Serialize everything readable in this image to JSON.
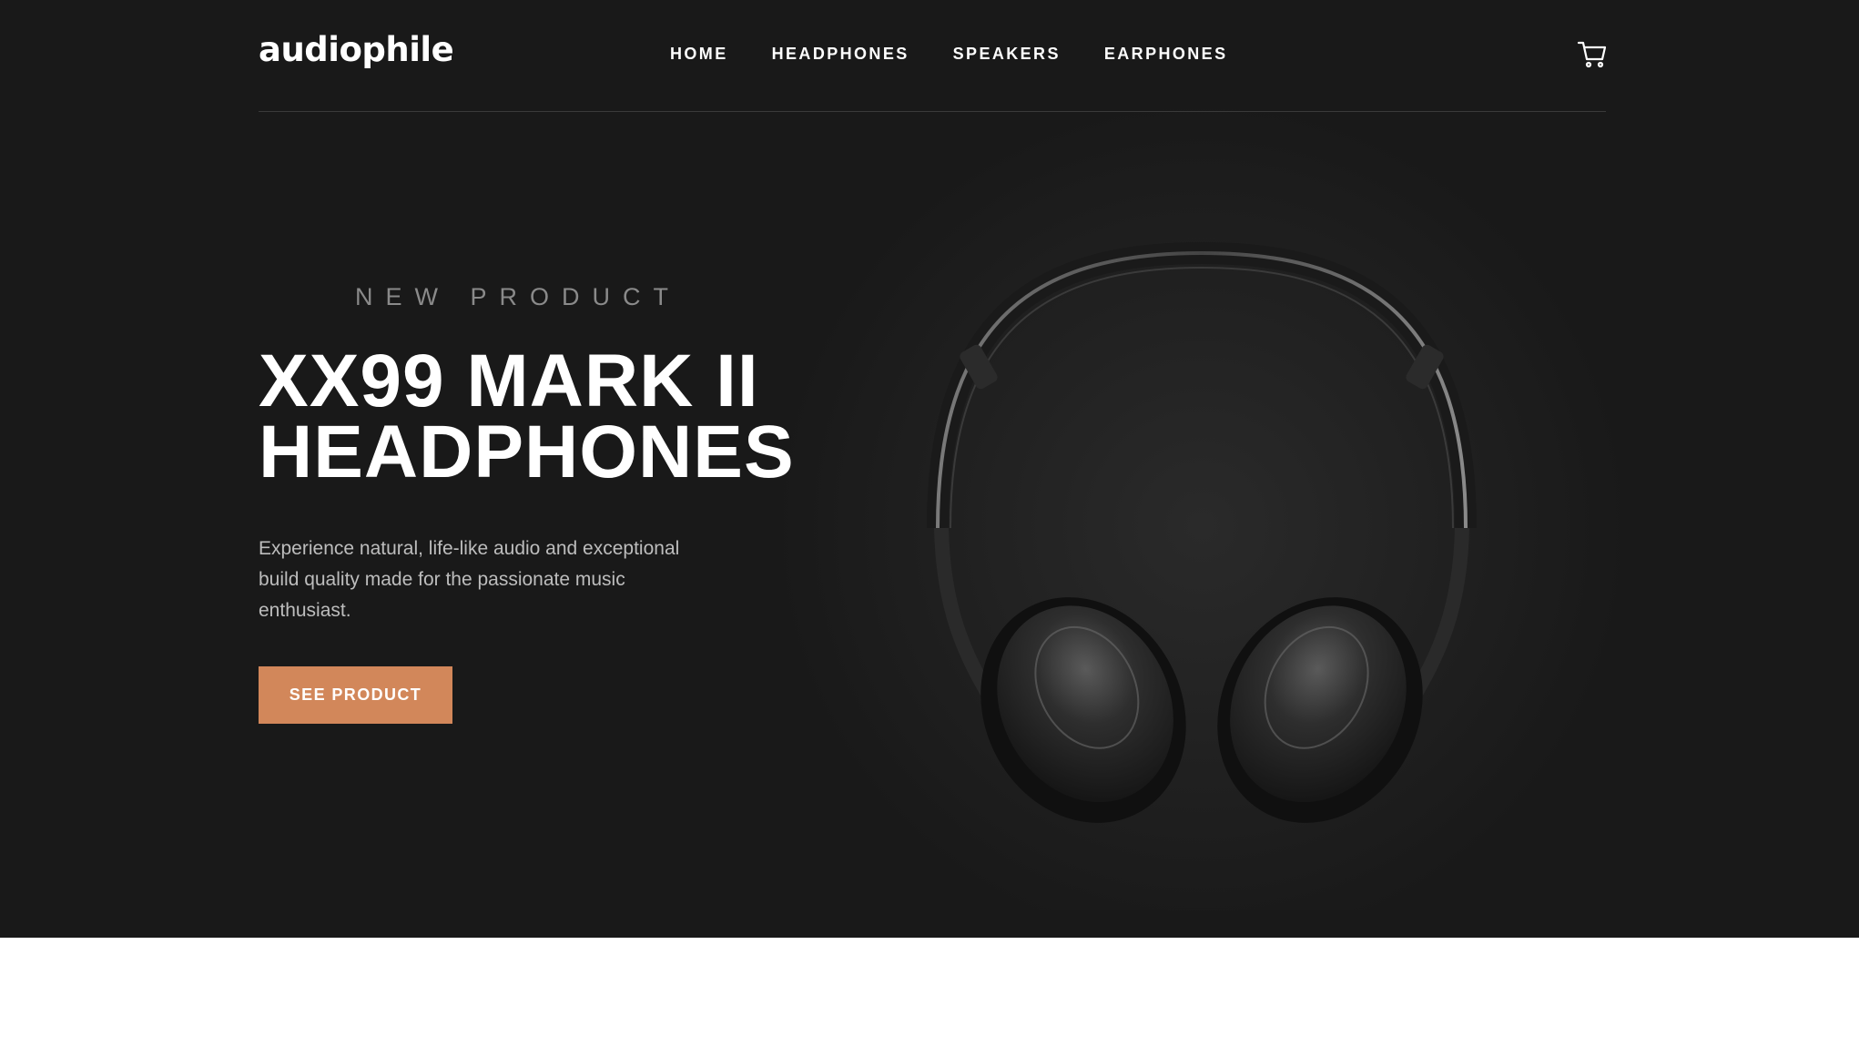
{
  "header": {
    "logo": "audiophile",
    "nav": [
      "HOME",
      "HEADPHONES",
      "SPEAKERS",
      "EARPHONES"
    ],
    "cart_icon": "cart-icon"
  },
  "hero": {
    "overline": "NEW PRODUCT",
    "title_line1": "XX99 MARK II",
    "title_line2": "HEADPHONES",
    "description": "Experience natural, life-like audio and exceptional build quality made for the passionate music enthusiast.",
    "cta_label": "SEE PRODUCT",
    "product_image": "headphones-image"
  },
  "colors": {
    "hero_background": "#191919",
    "accent": "#d2875a",
    "page_background": "#ffffff"
  }
}
